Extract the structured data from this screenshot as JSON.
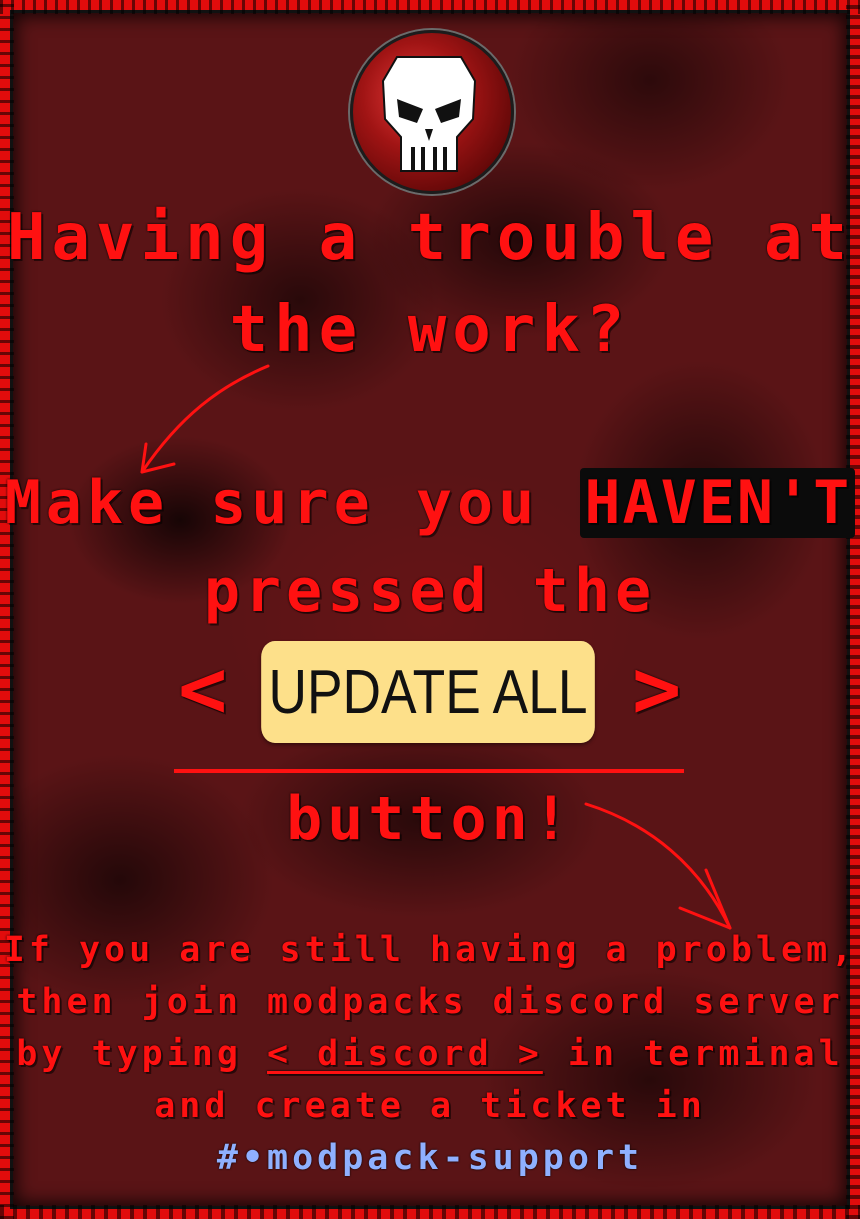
{
  "logo": {
    "icon": "skull-icon"
  },
  "headline": {
    "line1": "Having a trouble at",
    "line2": "the work?"
  },
  "warning": {
    "prefix": "Make sure you ",
    "emphasis": "HAVEN'T",
    "line2": "pressed the"
  },
  "button_graphic": {
    "bracket_left": "<",
    "label": "UPDATE ALL",
    "bracket_right": ">",
    "suffix": "button!"
  },
  "help": {
    "line1": "If you are still having a problem,",
    "line2": "then join modpacks discord server",
    "line3_prefix": "by typing ",
    "command": "< discord >",
    "line3_suffix": " in terminal",
    "line4": "and create a ticket in",
    "channel": "#•modpack-support"
  },
  "colors": {
    "accent_red": "#ff1111",
    "button_yellow": "#fde08a",
    "channel_blue": "#8fb0ff",
    "background": "#5a1416"
  }
}
